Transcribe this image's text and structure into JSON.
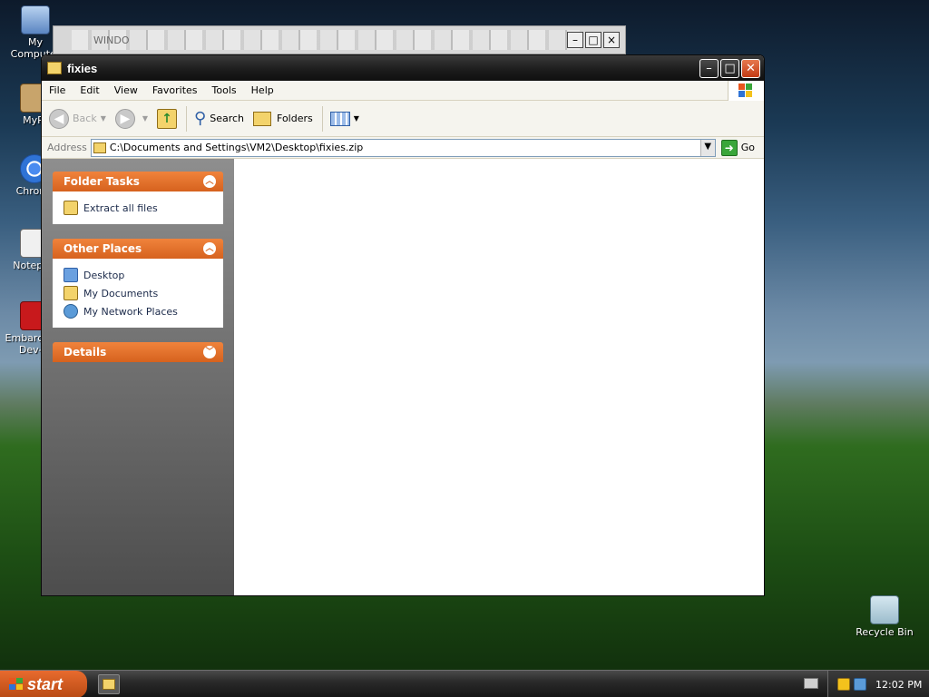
{
  "desktop": {
    "icons": [
      {
        "label": "My Computer",
        "icon": "my-computer-icon"
      },
      {
        "label": "MyPa",
        "icon": "mypapers-icon"
      },
      {
        "label": "Chrom",
        "icon": "chrome-icon"
      },
      {
        "label": "Notepa",
        "icon": "notepad-icon"
      },
      {
        "label": "Embarca Dev-C",
        "icon": "devcpp-icon"
      },
      {
        "label": "Recycle Bin",
        "icon": "recycle-bin-icon"
      }
    ],
    "ghost_window_text": "WINDO"
  },
  "window": {
    "title": "fixies",
    "menu": [
      "File",
      "Edit",
      "View",
      "Favorites",
      "Tools",
      "Help"
    ],
    "toolbar": {
      "back": "Back",
      "search": "Search",
      "folders": "Folders"
    },
    "address": {
      "label": "Address",
      "value": "C:\\Documents and Settings\\VM2\\Desktop\\fixies.zip",
      "go": "Go"
    },
    "panels": [
      {
        "title": "Folder Tasks",
        "items": [
          "Extract all files"
        ]
      },
      {
        "title": "Other Places",
        "items": [
          "Desktop",
          "My Documents",
          "My Network Places"
        ]
      },
      {
        "title": "Details",
        "items": []
      }
    ]
  },
  "taskbar": {
    "start_label": "start",
    "time": "12:02 PM"
  },
  "colors": {
    "panel_header": "#e06a24",
    "titlebar": "#1b1b1b",
    "close_button": "#c23a13",
    "start_button": "#d45a1e"
  }
}
